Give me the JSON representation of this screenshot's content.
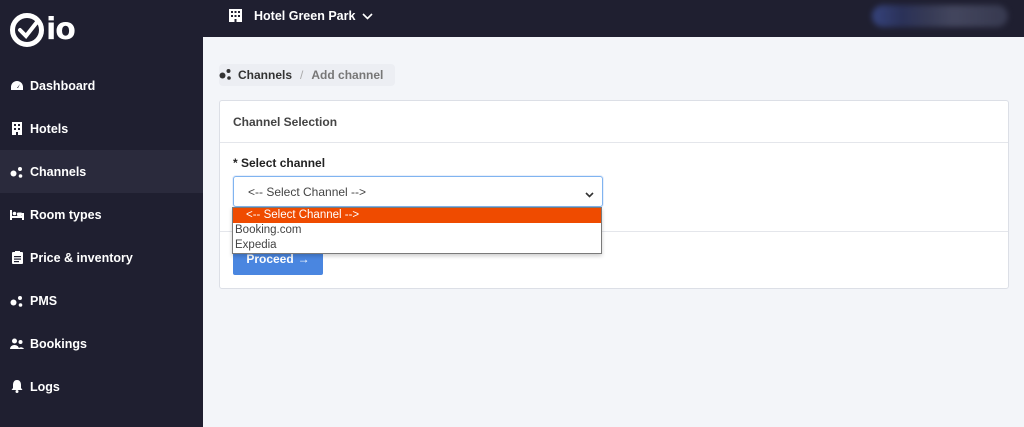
{
  "brand": {
    "logo_text": "io"
  },
  "sidebar": {
    "items": [
      {
        "label": "Dashboard",
        "icon": "dashboard-icon",
        "active": false
      },
      {
        "label": "Hotels",
        "icon": "hotel-icon",
        "active": false
      },
      {
        "label": "Channels",
        "icon": "channels-icon",
        "active": true
      },
      {
        "label": "Room types",
        "icon": "bed-icon",
        "active": false
      },
      {
        "label": "Price & inventory",
        "icon": "clipboard-icon",
        "active": false
      },
      {
        "label": "PMS",
        "icon": "pms-icon",
        "active": false
      },
      {
        "label": "Bookings",
        "icon": "users-icon",
        "active": false
      },
      {
        "label": "Logs",
        "icon": "bell-icon",
        "active": false
      }
    ]
  },
  "topbar": {
    "hotel_name": "Hotel Green Park"
  },
  "breadcrumb": {
    "parent": "Channels",
    "separator": "/",
    "current": "Add channel"
  },
  "card": {
    "title": "Channel Selection",
    "field_label": "* Select channel",
    "select_value": "<-- Select Channel -->",
    "proceed_label": "Proceed",
    "proceed_arrow": "→"
  },
  "dropdown": {
    "options": [
      "<-- Select Channel -->",
      "Booking.com",
      "Expedia"
    ],
    "selected_index": 0
  },
  "colors": {
    "sidebar_bg": "#1f1f30",
    "active_item_bg": "#2a2a3c",
    "accent_blue": "#4a86e0",
    "option_highlight": "#ef4b00"
  }
}
